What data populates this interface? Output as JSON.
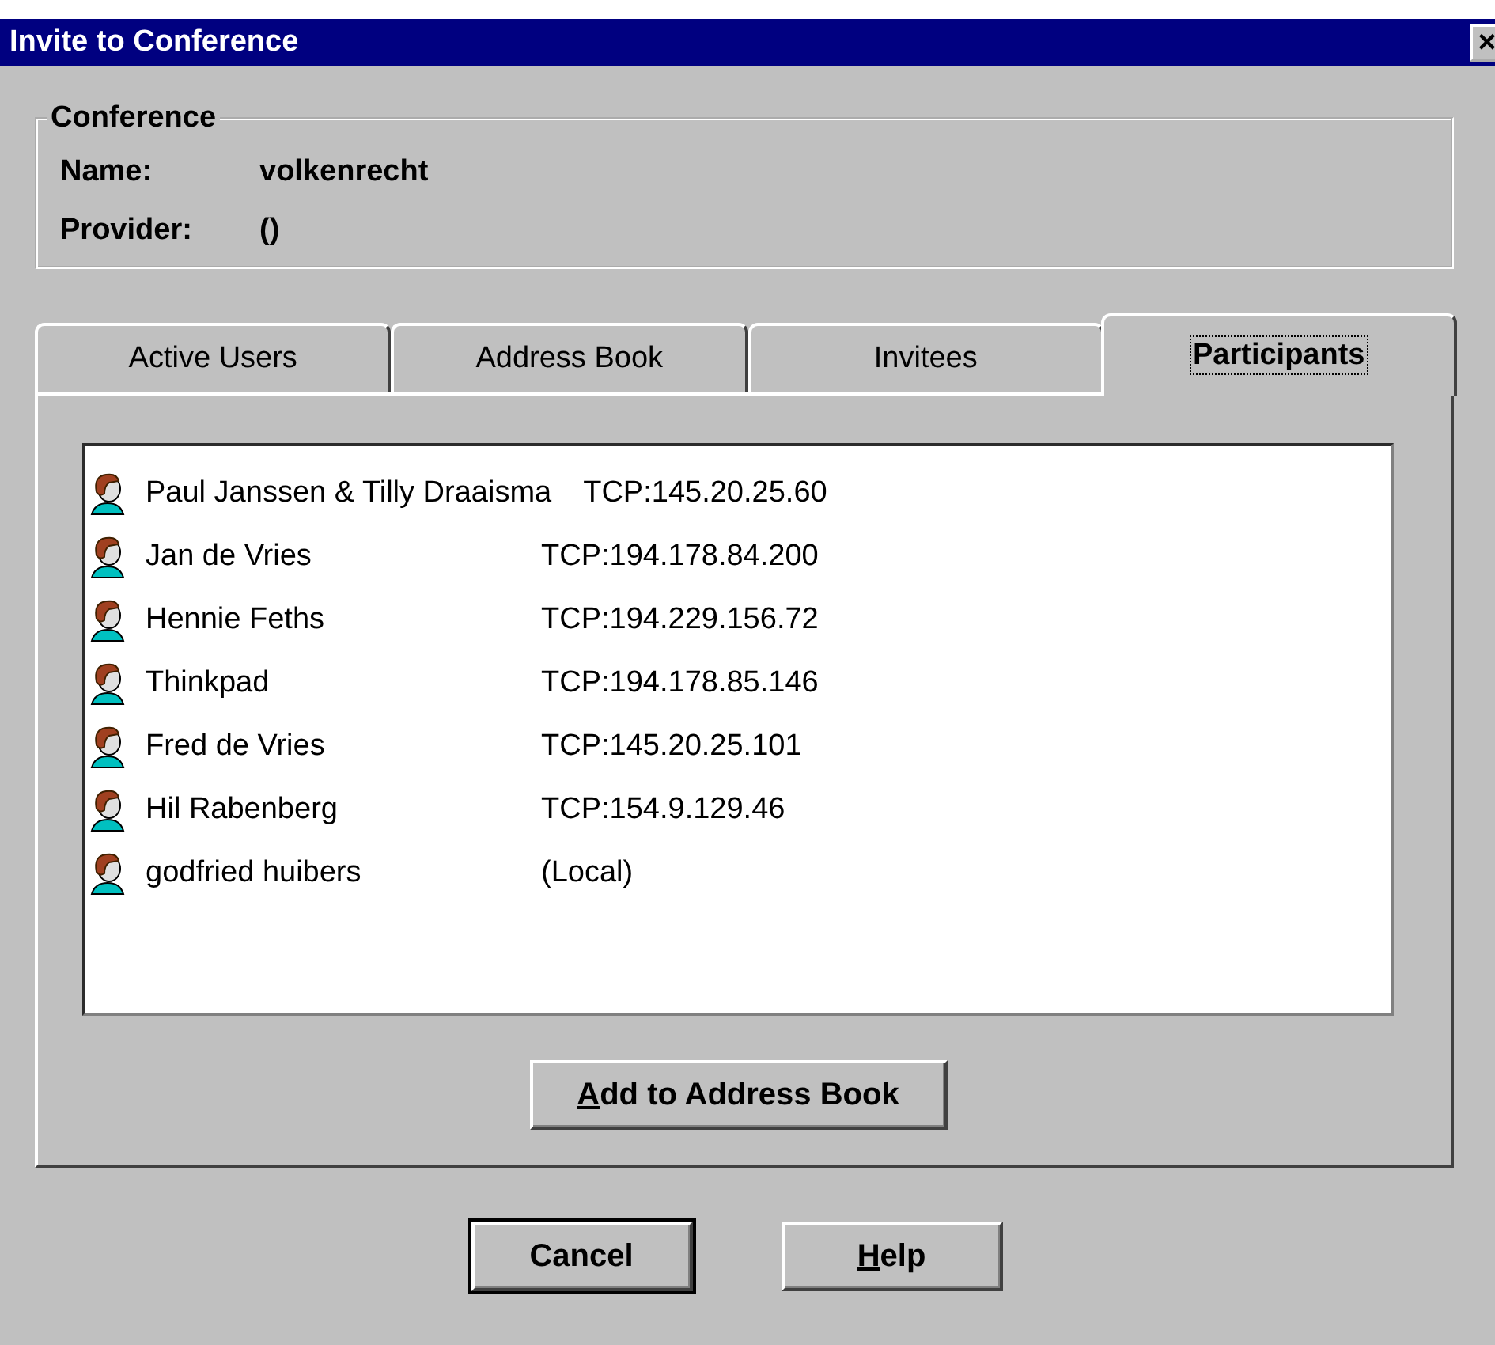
{
  "window": {
    "title": "Invite to Conference",
    "close": "×"
  },
  "conference": {
    "legend": "Conference",
    "fields": [
      {
        "label": "Name:",
        "value": "volkenrecht"
      },
      {
        "label": "Provider:",
        "value": "()"
      }
    ]
  },
  "tabs": [
    {
      "label": "Active Users",
      "selected": false
    },
    {
      "label": "Address Book",
      "selected": false
    },
    {
      "label": "Invitees",
      "selected": false
    },
    {
      "label": "Participants",
      "selected": true
    }
  ],
  "participants": [
    {
      "name": "Paul Janssen & Tilly Draaisma",
      "address": "TCP:145.20.25.60"
    },
    {
      "name": "Jan de Vries",
      "address": "TCP:194.178.84.200"
    },
    {
      "name": "Hennie Feths",
      "address": "TCP:194.229.156.72"
    },
    {
      "name": "Thinkpad",
      "address": "TCP:194.178.85.146"
    },
    {
      "name": "Fred de Vries",
      "address": "TCP:145.20.25.101"
    },
    {
      "name": "Hil Rabenberg",
      "address": "TCP:154.9.129.46"
    },
    {
      "name": "godfried huibers",
      "address": "(Local)"
    }
  ],
  "add_button": {
    "label": "Add to Address Book",
    "underline_first": true
  },
  "buttons": [
    {
      "label": "Cancel",
      "default": true,
      "underline_first": false
    },
    {
      "label": "Help",
      "default": false,
      "underline_first": true
    }
  ]
}
